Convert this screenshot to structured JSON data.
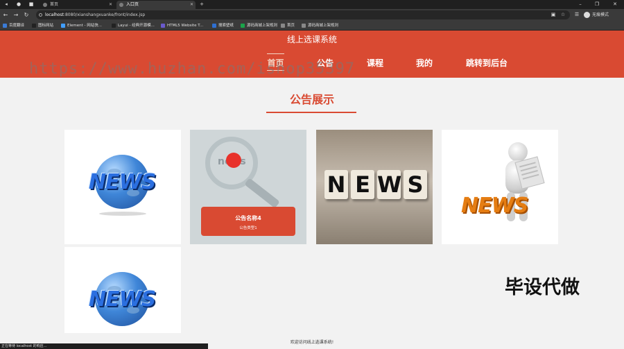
{
  "browser": {
    "tabs": [
      {
        "label": "首页"
      },
      {
        "label": "入口页"
      }
    ],
    "url_host": "localhost",
    "url_rest": ":8080/xianshangxuanke/front/index.jsp",
    "profile_label": "无痕模式",
    "bookmarks": [
      {
        "label": "百度翻译",
        "color": "#3a7bd5"
      },
      {
        "label": "图标网站",
        "color": "#222222"
      },
      {
        "label": "Element - 网站快...",
        "color": "#409eff"
      },
      {
        "label": "Layui - 经典开源模...",
        "color": "#222222"
      },
      {
        "label": "HTML5 Website T...",
        "color": "#6a5acd"
      },
      {
        "label": "搜索壁纸",
        "color": "#2e6fd1"
      },
      {
        "label": "源码商城上架规则",
        "color": "#1aa34a"
      },
      {
        "label": "首页",
        "color": "#888888"
      },
      {
        "label": "源码商城上架规则",
        "color": "#888888"
      }
    ],
    "status_text": "正在等待 localhost 的响应..."
  },
  "header": {
    "site_title": "线上选课系统",
    "nav": [
      {
        "label": "首页"
      },
      {
        "label": "公告"
      },
      {
        "label": "课程"
      },
      {
        "label": "我的"
      },
      {
        "label": "跳转到后台"
      }
    ]
  },
  "main": {
    "section_title": "公告展示",
    "cards": [
      {
        "image": "globe-news-image",
        "image_text": "NEWS"
      },
      {
        "image": "magnifier-news-image",
        "image_text": "news",
        "overlay_title": "公告名称4",
        "overlay_type": "公告类型1"
      },
      {
        "image": "dice-news-image",
        "letters": [
          "N",
          "E",
          "W",
          "S"
        ]
      },
      {
        "image": "man-news-image",
        "image_text": "NEWS"
      },
      {
        "image": "globe-news-image",
        "image_text": "NEWS"
      }
    ]
  },
  "footer": {
    "text": "欢迎访问线上选课系统!"
  },
  "overlays": {
    "watermark": "https://www.huzhan.com/ishop35397",
    "bottom_watermark": "毕设代做"
  },
  "colors": {
    "brand": "#d94a32",
    "nav_active": "#f5d7c6"
  }
}
